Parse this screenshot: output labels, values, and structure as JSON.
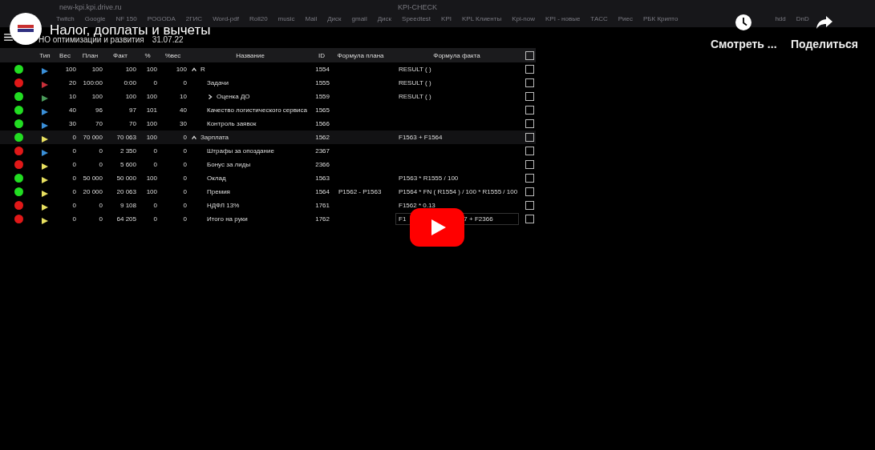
{
  "browser": {
    "url": "new-kpi.kpi.drive.ru",
    "tab_title": "KPI-CHECK",
    "bookmarks": [
      {
        "label": "Twitch"
      },
      {
        "label": "Google"
      },
      {
        "label": "NF 150"
      },
      {
        "label": "POGODA"
      },
      {
        "label": "2ГИС"
      },
      {
        "label": "Word-pdf"
      },
      {
        "label": "Roll20"
      },
      {
        "label": "music"
      },
      {
        "label": "Mail"
      },
      {
        "label": "Диск"
      },
      {
        "label": "gmail"
      },
      {
        "label": "Диск"
      },
      {
        "label": "Speedtest"
      },
      {
        "label": "KPI"
      },
      {
        "label": "KPL Клиенты"
      },
      {
        "label": "Kpi-now"
      },
      {
        "label": "KPI - новые"
      },
      {
        "label": "ТАСС"
      },
      {
        "label": "Риес"
      },
      {
        "label": "РБК Крипто"
      },
      {
        "label": "hdd"
      },
      {
        "label": "DnD"
      }
    ]
  },
  "header": {
    "department": "НО оптимизации и развития",
    "date": "31.07.22"
  },
  "table": {
    "columns": [
      "Тип",
      "Вес",
      "План",
      "Факт",
      "%",
      "%вес",
      "Название",
      "ID",
      "Формула плана",
      "Формула факта"
    ],
    "header_checked": false,
    "rows": [
      {
        "color": "#22dd22",
        "kind": "blue",
        "weight": "100",
        "plan": "100",
        "fact": "100",
        "pct": "100",
        "wpct": "100",
        "name": "R",
        "expanded": true,
        "id": "1554",
        "fact_formula": "RESULT ( )",
        "checked": false,
        "selected": false,
        "children": [
          {
            "color": "#e01818",
            "kind": "red",
            "weight": "20",
            "plan": "100:00",
            "fact": "0:00",
            "pct": "0",
            "wpct": "0",
            "name": "Задачи",
            "id": "1555",
            "fact_formula": "RESULT ( )",
            "checked": false,
            "selected": false
          },
          {
            "color": "#22dd22",
            "kind": "green",
            "weight": "10",
            "plan": "100",
            "fact": "100",
            "pct": "100",
            "wpct": "10",
            "name": "Оценка ДО",
            "expanded": false,
            "id": "1559",
            "fact_formula": "RESULT ( )",
            "checked": false,
            "selected": false
          },
          {
            "color": "#22dd22",
            "kind": "blue",
            "weight": "40",
            "plan": "96",
            "fact": "97",
            "pct": "101",
            "wpct": "40",
            "name": "Качество логистического сервиса",
            "id": "1565",
            "checked": false,
            "selected": false
          },
          {
            "color": "#22dd22",
            "kind": "blue",
            "weight": "30",
            "plan": "70",
            "fact": "70",
            "pct": "100",
            "wpct": "30",
            "name": "Контроль заявок",
            "id": "1566",
            "checked": false,
            "selected": false
          }
        ]
      },
      {
        "color": "#22dd22",
        "kind": "yellow",
        "weight": "0",
        "plan": "70 000",
        "fact": "70 063",
        "pct": "100",
        "wpct": "0",
        "name": "Зарплата",
        "expanded": true,
        "id": "1562",
        "fact_formula": "F1563 + F1564",
        "checked": false,
        "selected": true,
        "children": [
          {
            "color": "#e01818",
            "kind": "blue",
            "weight": "0",
            "plan": "0",
            "fact": "2 350",
            "pct": "0",
            "wpct": "0",
            "name": "Штрафы за опоздание",
            "id": "2367",
            "checked": false,
            "selected": false
          },
          {
            "color": "#e01818",
            "kind": "yellow",
            "weight": "0",
            "plan": "0",
            "fact": "5 600",
            "pct": "0",
            "wpct": "0",
            "name": "Бонус за лиды",
            "id": "2366",
            "checked": false,
            "selected": false
          },
          {
            "color": "#22dd22",
            "kind": "yellow",
            "weight": "0",
            "plan": "50 000",
            "fact": "50 000",
            "pct": "100",
            "wpct": "0",
            "name": "Оклад",
            "id": "1563",
            "fact_formula": "P1563 * R1555 / 100",
            "checked": false,
            "selected": false
          },
          {
            "color": "#22dd22",
            "kind": "yellow",
            "weight": "0",
            "plan": "20 000",
            "fact": "20 063",
            "pct": "100",
            "wpct": "0",
            "name": "Премия",
            "id": "1564",
            "plan_formula": "P1562 - P1563",
            "fact_formula": "P1564 * FN ( R1554 ) / 100 * R1555 / 100",
            "checked": false,
            "selected": false
          },
          {
            "color": "#e01818",
            "kind": "yellow",
            "weight": "0",
            "plan": "0",
            "fact": "9 108",
            "pct": "0",
            "wpct": "0",
            "name": "НДФЛ 13%",
            "id": "1761",
            "fact_formula": "F1562 * 0.13",
            "checked": false,
            "selected": false
          },
          {
            "color": "#e01818",
            "kind": "yellow",
            "weight": "0",
            "plan": "0",
            "fact": "64 205",
            "pct": "0",
            "wpct": "0",
            "name": "Итого на руки",
            "id": "1762",
            "fact_formula": "F1",
            "fact_formula_tail": "7 + F2366",
            "editing": true,
            "checked": false,
            "selected": false
          }
        ]
      }
    ]
  },
  "player": {
    "title": "Налог, доплаты и вычеты",
    "watch_later": "Смотреть ...",
    "share": "Поделиться"
  }
}
